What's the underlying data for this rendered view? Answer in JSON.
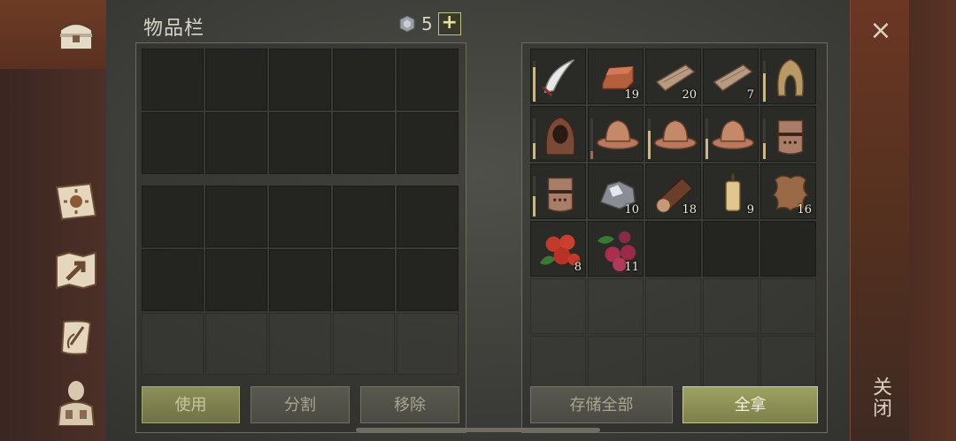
{
  "header": {
    "title": "物品栏",
    "currency_count": "5",
    "add_label": "+"
  },
  "sidebar": {
    "icons": [
      "chest-icon",
      "journal-sun-icon",
      "map-icon",
      "scroll-quill-icon",
      "character-icon"
    ]
  },
  "right_strip": {
    "close_symbol": "×",
    "close_label": "关闭"
  },
  "left_buttons": {
    "use": "使用",
    "split": "分割",
    "remove": "移除"
  },
  "right_buttons": {
    "store_all": "存储全部",
    "take_all": "全拿"
  },
  "storage": {
    "items": [
      {
        "name": "scimitar-icon",
        "qty": "",
        "durability": 0.85
      },
      {
        "name": "copper-ingot-icon",
        "qty": "19"
      },
      {
        "name": "wood-plank-icon",
        "qty": "20"
      },
      {
        "name": "wood-plank-icon",
        "qty": "7"
      },
      {
        "name": "hood-helmet-icon",
        "qty": "",
        "durability": 0.7
      },
      {
        "name": "brown-hood-icon",
        "qty": "",
        "durability": 0.4
      },
      {
        "name": "kettle-helmet-icon",
        "qty": "",
        "durability": 0.2,
        "low": true
      },
      {
        "name": "kettle-helmet-icon",
        "qty": "",
        "durability": 0.7
      },
      {
        "name": "kettle-helmet-icon",
        "qty": "",
        "durability": 0.5
      },
      {
        "name": "great-helm-icon",
        "qty": "",
        "durability": 0.4
      },
      {
        "name": "great-helm-icon",
        "qty": "",
        "durability": 0.5
      },
      {
        "name": "silver-ore-icon",
        "qty": "10"
      },
      {
        "name": "log-icon",
        "qty": "18"
      },
      {
        "name": "candle-icon",
        "qty": "9"
      },
      {
        "name": "leather-hide-icon",
        "qty": "16"
      },
      {
        "name": "red-berries-icon",
        "qty": "8"
      },
      {
        "name": "purple-berries-icon",
        "qty": "11"
      }
    ]
  },
  "colors": {
    "accent_green": "#9da263",
    "frame": "#6e6c60",
    "leather": "#5a3020"
  }
}
